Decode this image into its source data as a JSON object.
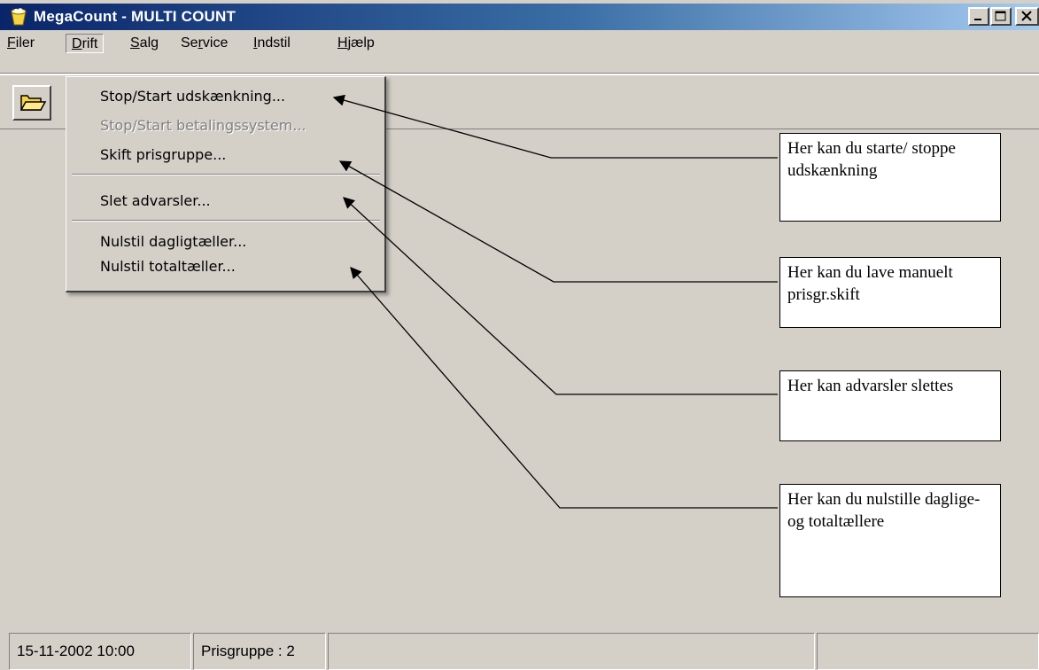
{
  "window": {
    "title": "MegaCount - MULTI COUNT",
    "icon": "app-icon"
  },
  "menubar": {
    "items": [
      {
        "label": "Filer",
        "icon": null
      },
      {
        "label": "Drift",
        "icon": null
      },
      {
        "label": "Salg",
        "icon": null
      },
      {
        "label": "Service",
        "icon": null
      },
      {
        "label": "Indstil",
        "icon": null
      },
      {
        "label": "Hjælp",
        "icon": null
      }
    ]
  },
  "toolbar": {
    "open_icon": "folder-open-icon"
  },
  "dropdown": {
    "items": [
      {
        "label": "Stop/Start udskænkning...",
        "enabled": true
      },
      {
        "label": "Stop/Start betalingssystem...",
        "enabled": false
      },
      {
        "label": "Skift prisgruppe...",
        "enabled": true
      },
      {
        "label": "Slet advarsler...",
        "enabled": true
      },
      {
        "label": "Nulstil dagligtæller...",
        "enabled": true
      },
      {
        "label": "Nulstil totaltæller...",
        "enabled": true
      }
    ]
  },
  "callouts": [
    {
      "text": "Her kan du starte/ stoppe udskænkning"
    },
    {
      "text": "Her kan du lave manuelt prisgr.skift"
    },
    {
      "text": "Her kan advarsler slettes"
    },
    {
      "text": "Her kan du nulstille daglige- og totaltællere"
    }
  ],
  "statusbar": {
    "datetime": "15-11-2002 10:00",
    "pricegroup": "Prisgruppe : 2",
    "panel3": "",
    "panel4": ""
  },
  "colors": {
    "titlebar_start": "#0a246a",
    "titlebar_end": "#a6caf0",
    "face": "#d4d0c8",
    "disabled_text": "#808080"
  }
}
